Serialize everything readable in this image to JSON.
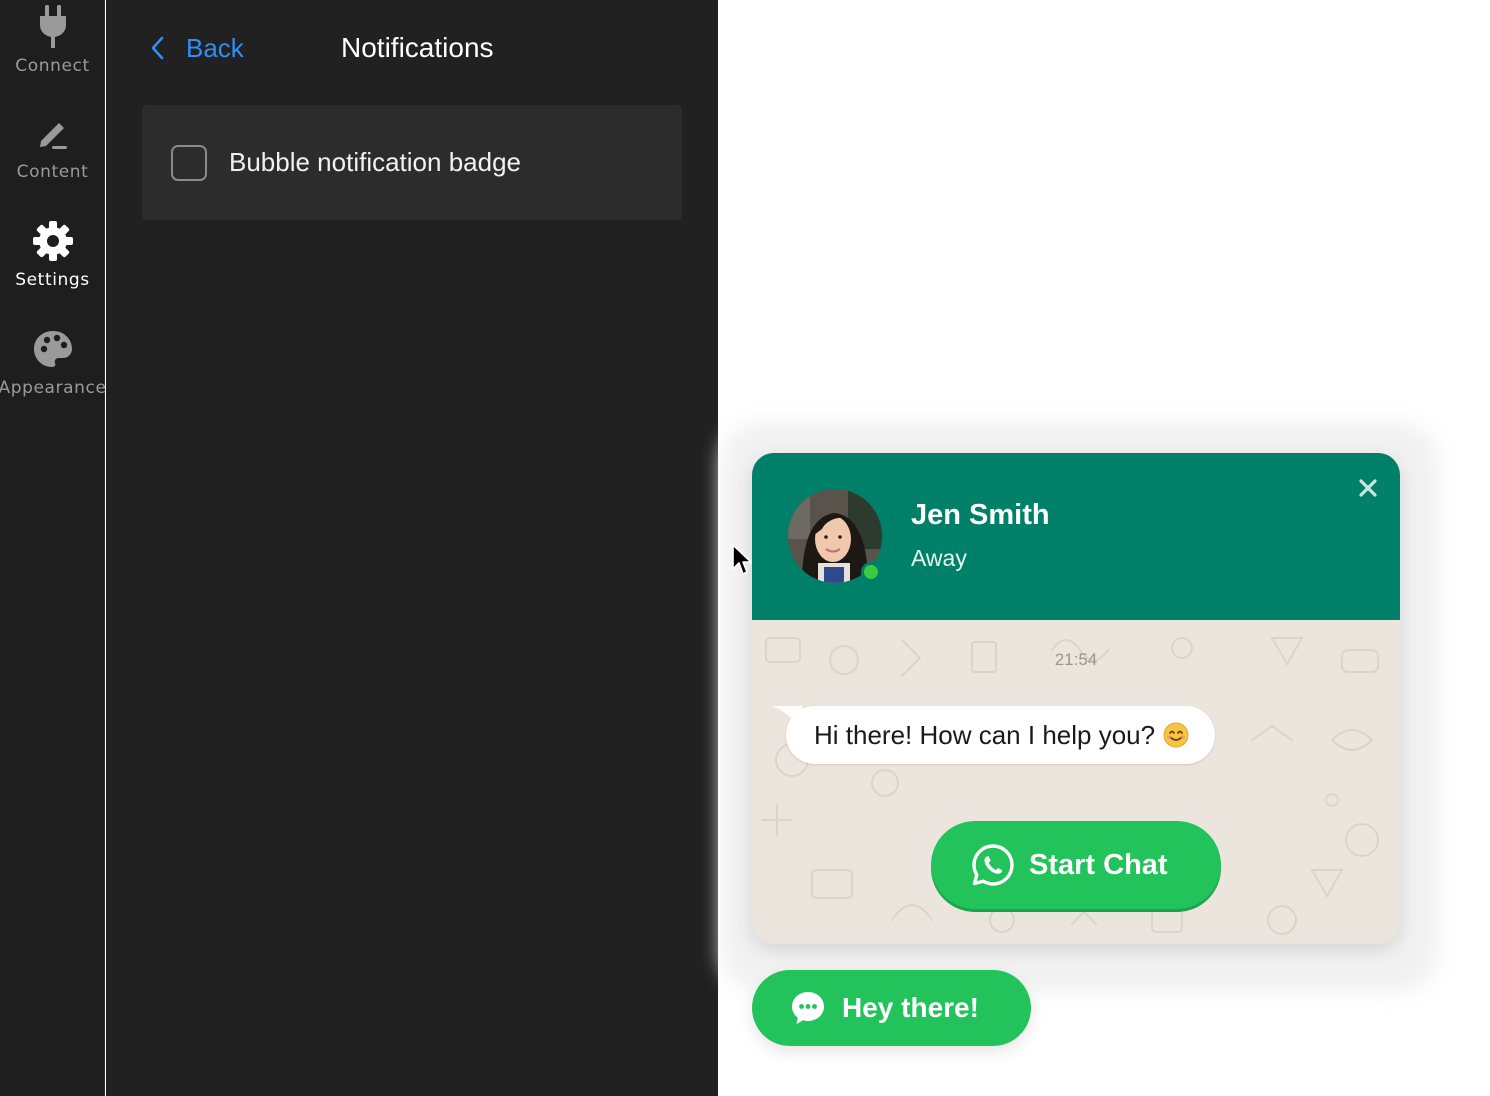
{
  "sidebar": {
    "items": [
      {
        "label": "Connect",
        "icon": "plug-icon",
        "active": false
      },
      {
        "label": "Content",
        "icon": "pen-icon",
        "active": false
      },
      {
        "label": "Settings",
        "icon": "gear-icon",
        "active": true
      },
      {
        "label": "Appearance",
        "icon": "palette-icon",
        "active": false
      }
    ]
  },
  "panel": {
    "back_label": "Back",
    "title": "Notifications",
    "option": {
      "label": "Bubble notification badge",
      "checked": false
    }
  },
  "widget": {
    "agent_name": "Jen Smith",
    "agent_status": "Away",
    "timestamp": "21:54",
    "message": "Hi there! How can I help you?",
    "start_chat_label": "Start Chat",
    "bubble_label": "Hey there!"
  },
  "colors": {
    "brand_green": "#008069",
    "button_green": "#23c35b",
    "link_blue": "#2f8ff5",
    "online_dot": "#3ccb3c"
  }
}
